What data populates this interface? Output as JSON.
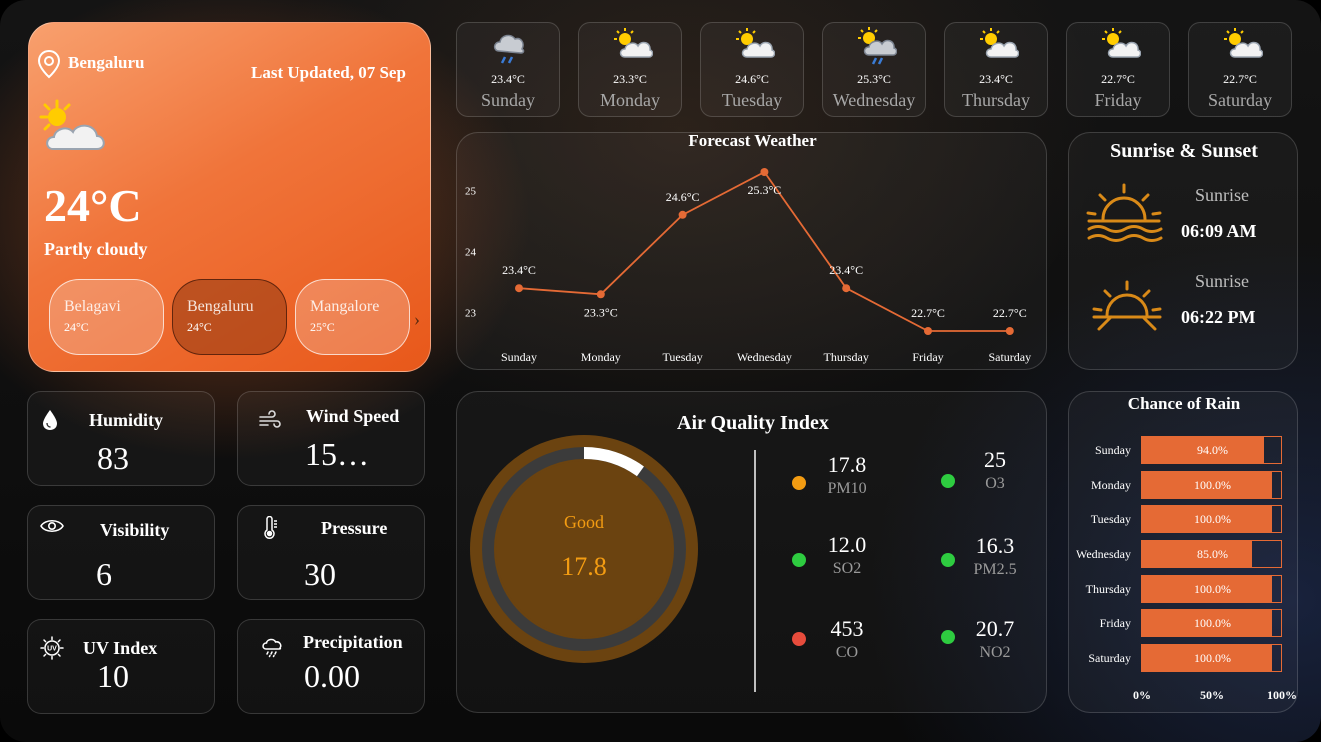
{
  "location": {
    "city": "Bengaluru",
    "last_updated": "Last Updated, 07 Sep",
    "temperature": "24°C",
    "condition": "Partly cloudy"
  },
  "cities": [
    {
      "name": "Belagavi",
      "temp": "24°C",
      "active": false
    },
    {
      "name": "Bengaluru",
      "temp": "24°C",
      "active": true
    },
    {
      "name": "Mangalore",
      "temp": "25°C",
      "active": false
    }
  ],
  "city_next_glyph": "›",
  "days": [
    {
      "name": "Sunday",
      "temp": "23.4°C",
      "icon": "rain-cloud-icon"
    },
    {
      "name": "Monday",
      "temp": "23.3°C",
      "icon": "partly-cloudy-icon"
    },
    {
      "name": "Tuesday",
      "temp": "24.6°C",
      "icon": "partly-cloudy-icon"
    },
    {
      "name": "Wednesday",
      "temp": "25.3°C",
      "icon": "sun-rain-cloud-icon"
    },
    {
      "name": "Thursday",
      "temp": "23.4°C",
      "icon": "partly-cloudy-icon"
    },
    {
      "name": "Friday",
      "temp": "22.7°C",
      "icon": "partly-cloudy-icon"
    },
    {
      "name": "Saturday",
      "temp": "22.7°C",
      "icon": "partly-cloudy-icon"
    }
  ],
  "stats": {
    "humidity": {
      "label": "Humidity",
      "value": "83",
      "icon": "water-drop-icon"
    },
    "wind": {
      "label": "Wind Speed",
      "value": "15…",
      "icon": "wind-icon"
    },
    "visibility": {
      "label": "Visibility",
      "value": "6",
      "icon": "eye-icon"
    },
    "pressure": {
      "label": "Pressure",
      "value": "30",
      "icon": "thermometer-icon"
    },
    "uv": {
      "label": "UV Index",
      "value": "10",
      "icon": "uv-sun-icon"
    },
    "precipitation": {
      "label": "Precipitation",
      "value": "0.00",
      "icon": "rain-cloud-icon"
    }
  },
  "sun": {
    "title": "Sunrise & Sunset",
    "rise_label": "Sunrise",
    "rise_time": "06:09 AM",
    "set_label": "Sunrise",
    "set_time": "06:22 PM"
  },
  "aqi": {
    "title": "Air Quality Index",
    "status": "Good",
    "value": "17.8",
    "gauge_fraction": 0.1,
    "items": [
      {
        "name": "PM10",
        "value": "17.8",
        "color": "#f39c12"
      },
      {
        "name": "O3",
        "value": "25",
        "color": "#2ecc40"
      },
      {
        "name": "SO2",
        "value": "12.0",
        "color": "#2ecc40"
      },
      {
        "name": "PM2.5",
        "value": "16.3",
        "color": "#2ecc40"
      },
      {
        "name": "CO",
        "value": "453",
        "color": "#e74c3c"
      },
      {
        "name": "NO2",
        "value": "20.7",
        "color": "#2ecc40"
      }
    ]
  },
  "rain": {
    "title": "Chance of Rain",
    "rows": [
      {
        "day": "Sunday",
        "value": 94.0,
        "label": "94.0%"
      },
      {
        "day": "Monday",
        "value": 100.0,
        "label": "100.0%"
      },
      {
        "day": "Tuesday",
        "value": 100.0,
        "label": "100.0%"
      },
      {
        "day": "Wednesday",
        "value": 85.0,
        "label": "85.0%"
      },
      {
        "day": "Thursday",
        "value": 100.0,
        "label": "100.0%"
      },
      {
        "day": "Friday",
        "value": 100.0,
        "label": "100.0%"
      },
      {
        "day": "Saturday",
        "value": 100.0,
        "label": "100.0%"
      }
    ],
    "axis": [
      "0%",
      "50%",
      "100%"
    ]
  },
  "colors": {
    "accent": "#e56a35",
    "card_orange": "#f0743a",
    "aqi_ring": "#6b4310",
    "aqi_text": "#f39c12"
  },
  "chart_data": {
    "type": "line",
    "title": "Forecast Weather",
    "categories": [
      "Sunday",
      "Monday",
      "Tuesday",
      "Wednesday",
      "Thursday",
      "Friday",
      "Saturday"
    ],
    "values": [
      23.4,
      23.3,
      24.6,
      25.3,
      23.4,
      22.7,
      22.7
    ],
    "data_labels": [
      "23.4°C",
      "23.3°C",
      "24.6°C",
      "25.3°C",
      "23.4°C",
      "22.7°C",
      "22.7°C"
    ],
    "yticks": [
      "23",
      "24",
      "25"
    ],
    "ylim": [
      22.7,
      25.3
    ],
    "xlabel": "",
    "ylabel": "",
    "grid": false,
    "line_color": "#e56a35"
  }
}
